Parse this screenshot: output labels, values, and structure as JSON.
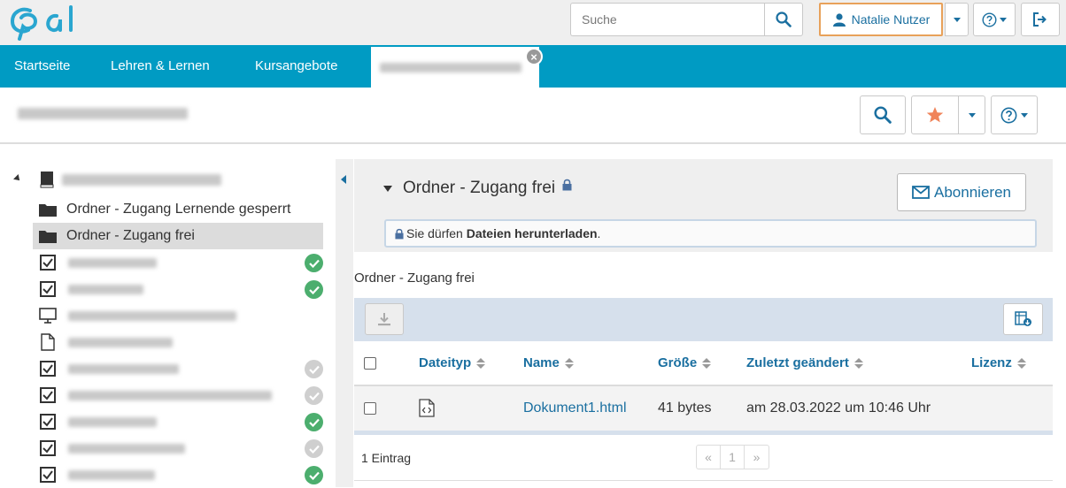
{
  "header": {
    "search_placeholder": "Suche",
    "user_name": "Natalie Nutzer",
    "accent_color": "#009bc3"
  },
  "nav": {
    "items": [
      "Startseite",
      "Lehren & Lernen",
      "Kursangebote"
    ]
  },
  "tree": {
    "folder_locked": "Ordner - Zugang Lernende gesperrt",
    "folder_open": "Ordner - Zugang frei"
  },
  "folder": {
    "title": "Ordner - Zugang frei",
    "subscribe_label": "Abonnieren",
    "info_prefix": "Sie dürfen ",
    "info_bold": "Dateien herunterladen",
    "info_suffix": ".",
    "section_label": "Ordner - Zugang frei"
  },
  "table": {
    "columns": [
      "Dateityp",
      "Name",
      "Größe",
      "Zuletzt geändert",
      "Lizenz"
    ],
    "rows": [
      {
        "type_icon": "html-file-icon",
        "name": "Dokument1.html",
        "size": "41 bytes",
        "modified": "am 28.03.2022 um 10:46 Uhr",
        "license": ""
      }
    ],
    "count_label": "1 Eintrag",
    "pager": {
      "prev": "«",
      "page": "1",
      "next": "»"
    }
  }
}
